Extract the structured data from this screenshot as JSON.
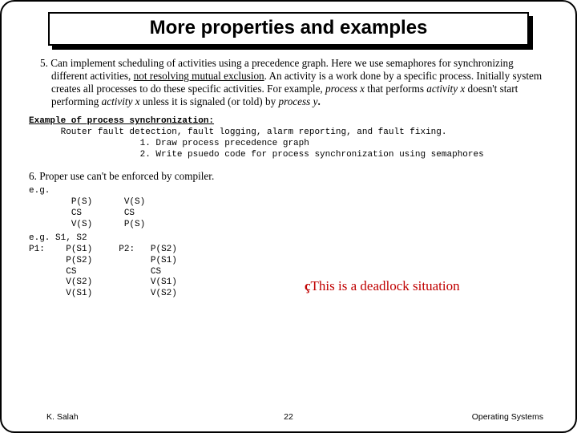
{
  "title": "More properties and examples",
  "point5_lead": "5. Can implement scheduling of activities using a precedence graph. ",
  "point5_after_lead": "Here we use semaphores for synchronizing different activities, ",
  "point5_underlined": "not resolving mutual exclusion",
  "point5_rest1": ". An activity is a work done by a specific process. Initially system creates all processes to do these specific activities.  For example,  ",
  "point5_px": "process x",
  "point5_rest2": " that performs ",
  "point5_ax": "activity x",
  "point5_rest3": " doesn't start performing ",
  "point5_ax2": "activity x",
  "point5_rest4": " unless it is signaled (or told) by ",
  "point5_py": "process y",
  "point5_end": ".",
  "example_heading": "Example of process synchronization:",
  "example_line1": "Router fault detection, fault logging, alarm reporting, and fault fixing.",
  "example_item1": "1. Draw process precedence graph",
  "example_item2": "2. Write psuedo code for process synchronization using semaphores",
  "point6": "6. Proper use can't be enforced by compiler.",
  "eg1_label": "e.g.",
  "eg1_col1_l1": "P(S)",
  "eg1_col1_l2": "CS",
  "eg1_col1_l3": "V(S)",
  "eg1_col2_l1": "V(S)",
  "eg1_col2_l2": "CS",
  "eg1_col2_l3": "P(S)",
  "eg2_label": "e.g. S1, S2",
  "p1_label": "P1:",
  "p1_l1": "P(S1)",
  "p1_l2": "P(S2)",
  "p1_l3": "CS",
  "p1_l4": "V(S2)",
  "p1_l5": "V(S1)",
  "p2_label": "P2:",
  "p2_l1": "P(S2)",
  "p2_l2": "P(S1)",
  "p2_l3": "CS",
  "p2_l4": "V(S1)",
  "p2_l5": "V(S2)",
  "callout_arrow": "ç",
  "callout_text": "This is a deadlock situation",
  "footer_left": "K. Salah",
  "footer_center": "22",
  "footer_right": "Operating Systems"
}
